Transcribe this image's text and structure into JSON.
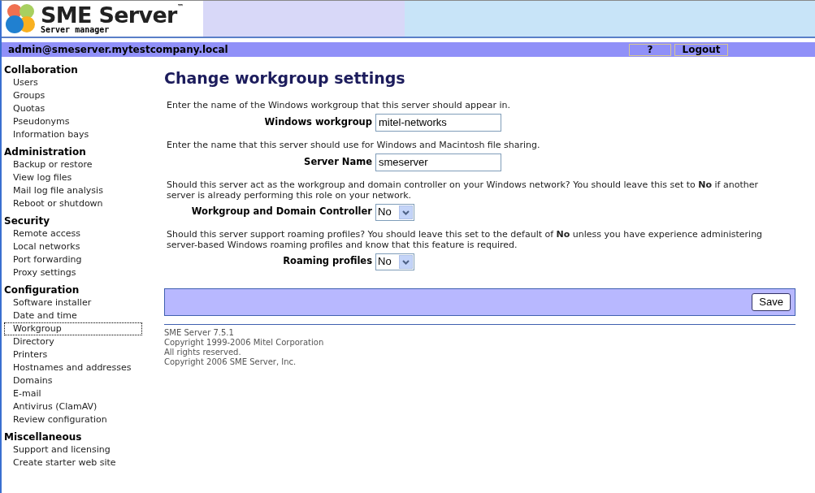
{
  "header": {
    "title": "SME Server",
    "trademark": "™",
    "subtitle": "Server manager"
  },
  "user_bar": {
    "user": "admin@smeserver.mytestcompany.local",
    "buttons": [
      "?",
      "Logout"
    ]
  },
  "sidebar": {
    "sections": [
      {
        "heading": "Collaboration",
        "items": [
          {
            "label": "Users",
            "selected": false
          },
          {
            "label": "Groups",
            "selected": false
          },
          {
            "label": "Quotas",
            "selected": false
          },
          {
            "label": "Pseudonyms",
            "selected": false
          },
          {
            "label": "Information bays",
            "selected": false
          }
        ]
      },
      {
        "heading": "Administration",
        "items": [
          {
            "label": "Backup or restore",
            "selected": false
          },
          {
            "label": "View log files",
            "selected": false
          },
          {
            "label": "Mail log file analysis",
            "selected": false
          },
          {
            "label": "Reboot or shutdown",
            "selected": false
          }
        ]
      },
      {
        "heading": "Security",
        "items": [
          {
            "label": "Remote access",
            "selected": false
          },
          {
            "label": "Local networks",
            "selected": false
          },
          {
            "label": "Port forwarding",
            "selected": false
          },
          {
            "label": "Proxy settings",
            "selected": false
          }
        ]
      },
      {
        "heading": "Configuration",
        "items": [
          {
            "label": "Software installer",
            "selected": false
          },
          {
            "label": "Date and time",
            "selected": false
          },
          {
            "label": "Workgroup",
            "selected": true
          },
          {
            "label": "Directory",
            "selected": false
          },
          {
            "label": "Printers",
            "selected": false
          },
          {
            "label": "Hostnames and addresses",
            "selected": false
          },
          {
            "label": "Domains",
            "selected": false
          },
          {
            "label": "E-mail",
            "selected": false
          },
          {
            "label": "Antivirus (ClamAV)",
            "selected": false
          },
          {
            "label": "Review configuration",
            "selected": false
          }
        ]
      },
      {
        "heading": "Miscellaneous",
        "items": [
          {
            "label": "Support and licensing",
            "selected": false
          },
          {
            "label": "Create starter web site",
            "selected": false
          }
        ]
      }
    ]
  },
  "page": {
    "title": "Change workgroup settings",
    "fields": [
      {
        "kind": "text",
        "description": "Enter the name of the Windows workgroup that this server should appear in.",
        "label": "Windows workgroup",
        "value": "mitel-networks"
      },
      {
        "kind": "text",
        "description": "Enter the name that this server should use for Windows and Macintosh file sharing.",
        "label": "Server Name",
        "value": "smeserver"
      },
      {
        "kind": "select",
        "description": "Should this server act as the workgroup and domain controller on your Windows network? You should leave this set to **No** if another server is already performing this role on your network.",
        "label": "Workgroup and Domain Controller",
        "value": "No"
      },
      {
        "kind": "select",
        "description": "Should this server support roaming profiles? You should leave this set to the default of **No** unless you have experience administering server-based Windows roaming profiles and know that this feature is required.",
        "label": "Roaming profiles",
        "value": "No"
      }
    ],
    "save_button": "Save"
  },
  "footer": [
    "SME Server 7.5.1",
    "Copyright 1999-2006 Mitel Corporation",
    "All rights reserved.",
    "Copyright 2006 SME Server, Inc."
  ]
}
